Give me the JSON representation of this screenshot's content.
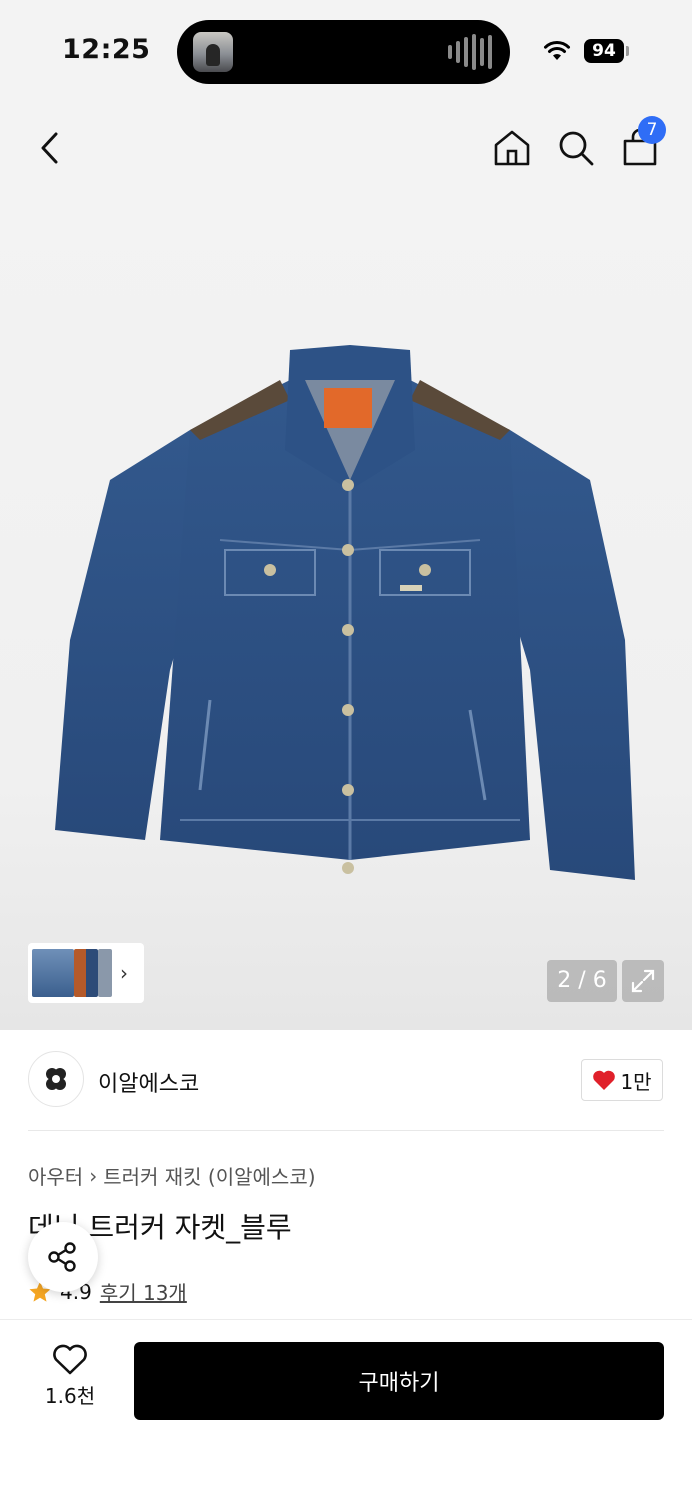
{
  "status_bar": {
    "time": "12:25",
    "battery": "94"
  },
  "nav": {
    "cart_count": "7"
  },
  "gallery": {
    "counter": "2 / 6"
  },
  "brand": {
    "name": "이알에스코",
    "likes": "1만"
  },
  "breadcrumb": {
    "category": "아우터",
    "subcategory": "트러커 재킷 (이알에스코)"
  },
  "product": {
    "title": "데님 트러커 자켓_블루",
    "rating": "4.9",
    "reviews": "후기 13개"
  },
  "bottom_bar": {
    "wish_count": "1.6천",
    "buy_label": "구매하기"
  },
  "colors": {
    "accent_badge": "#2f6df6",
    "heart": "#e0202a",
    "star": "#f5a623",
    "denim": "#2e5488"
  }
}
